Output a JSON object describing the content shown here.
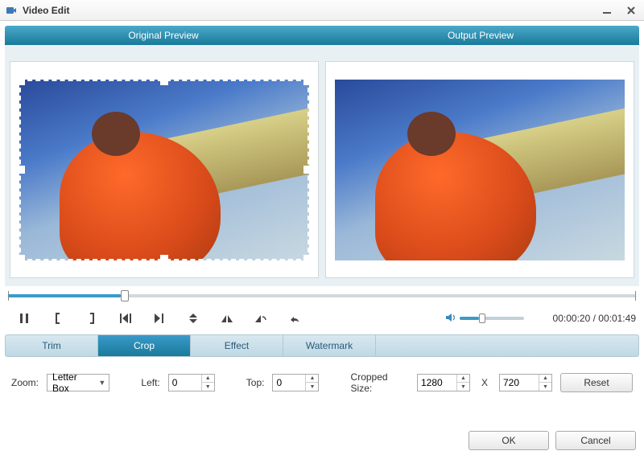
{
  "window": {
    "title": "Video Edit"
  },
  "previews": {
    "left": "Original Preview",
    "right": "Output Preview"
  },
  "time": {
    "current": "00:00:20",
    "total": "00:01:49",
    "sep": " / "
  },
  "tabs": {
    "trim": "Trim",
    "crop": "Crop",
    "effect": "Effect",
    "watermark": "Watermark"
  },
  "crop": {
    "zoom_label": "Zoom:",
    "zoom_value": "Letter Box",
    "left_label": "Left:",
    "left_value": "0",
    "top_label": "Top:",
    "top_value": "0",
    "size_label": "Cropped Size:",
    "width": "1280",
    "height": "720",
    "x": "X",
    "reset": "Reset"
  },
  "footer": {
    "ok": "OK",
    "cancel": "Cancel"
  }
}
